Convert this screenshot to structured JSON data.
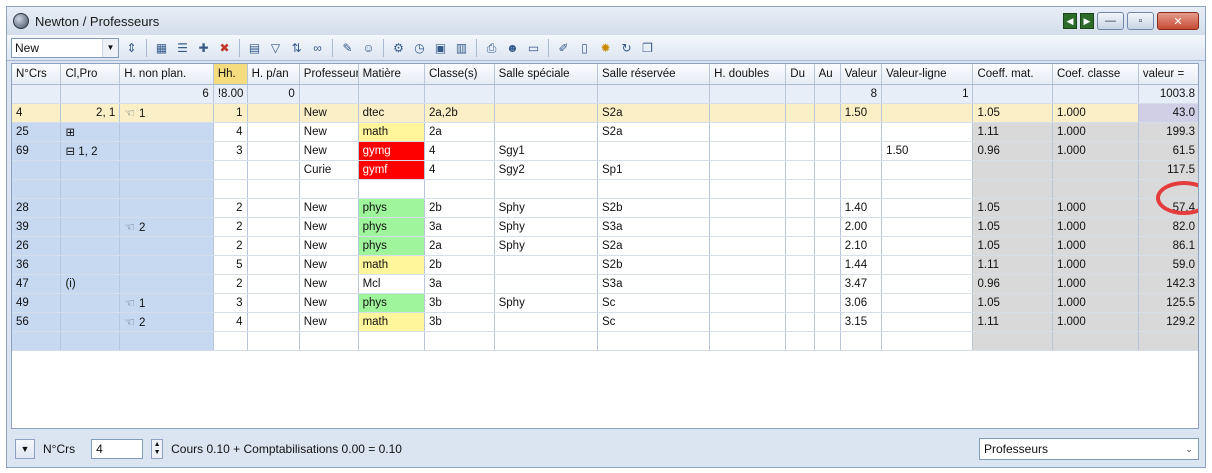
{
  "window": {
    "title": "Newton / Professeurs"
  },
  "toolbar": {
    "filter_value": "New",
    "icons": [
      "grid-icon",
      "list-icon",
      "new-icon",
      "delete-icon",
      "chart-icon",
      "filter-icon",
      "sort-icon",
      "link-icon",
      "tools-icon",
      "teacher-icon",
      "settings-icon",
      "clock-icon",
      "calendar-icon",
      "table-icon",
      "print-icon",
      "people-icon",
      "monitor-icon",
      "edit-icon",
      "document-icon",
      "gear-icon",
      "cycle-icon",
      "window-icon"
    ]
  },
  "table": {
    "headers": [
      "N°Crs",
      "Cl,Pro",
      "H. non plan.",
      "Hh.",
      "H. p/an",
      "Professeur",
      "Matière",
      "Classe(s)",
      "Salle spéciale",
      "Salle réservée",
      "H. doubles",
      "Du",
      "Au",
      "Valeur",
      "Valeur-ligne",
      "Coeff. mat.",
      "Coef. classe",
      "valeur ="
    ],
    "sum_row": [
      "",
      "",
      "6",
      "!8.00",
      "0",
      "",
      "",
      "",
      "",
      "",
      "",
      "",
      "",
      "8",
      "1",
      "",
      "",
      "1003.8"
    ],
    "rows": [
      {
        "crs": "4",
        "cl": "2, 1",
        "hnp": "1",
        "hh": "1",
        "hpan": "",
        "prof": "New",
        "mat": "dtec",
        "mat_style": "none",
        "cls": "2a,2b",
        "ss": "",
        "sr": "S2a",
        "hd": "",
        "du": "",
        "au": "",
        "val": "1.50",
        "vl": "",
        "cm": "1.05",
        "cc": "1.000",
        "v": "43.0",
        "selected": true
      },
      {
        "crs": "25",
        "cl": "⊞",
        "hnp": "",
        "hh": "4",
        "hpan": "",
        "prof": "New",
        "mat": "math",
        "mat_style": "math",
        "cls": "2a",
        "ss": "",
        "sr": "S2a",
        "hd": "",
        "du": "",
        "au": "",
        "val": "",
        "vl": "",
        "cm": "1.11",
        "cc": "1.000",
        "v": "199.3"
      },
      {
        "crs": "69",
        "cl": "⊟ 1, 2",
        "hnp": "",
        "hh": "3",
        "hpan": "",
        "prof": "New",
        "mat": "gymg",
        "mat_style": "gym",
        "cls": "4",
        "ss": "Sgy1",
        "sr": "",
        "hd": "",
        "du": "",
        "au": "",
        "val": "",
        "vl": "1.50",
        "cm": "0.96",
        "cc": "1.000",
        "v": "61.5"
      },
      {
        "crs": "",
        "cl": "",
        "hnp": "",
        "hh": "",
        "hpan": "",
        "prof": "Curie",
        "mat": "gymf",
        "mat_style": "gym",
        "cls": "4",
        "ss": "Sgy2",
        "sr": "Sp1",
        "hd": "",
        "du": "",
        "au": "",
        "val": "",
        "vl": "",
        "cm": "",
        "cc": "",
        "v": "117.5"
      },
      {
        "crs": "",
        "cl": "",
        "hnp": "",
        "hh": "",
        "hpan": "",
        "prof": "",
        "mat": "",
        "mat_style": "none",
        "cls": "",
        "ss": "",
        "sr": "",
        "hd": "",
        "du": "",
        "au": "",
        "val": "",
        "vl": "",
        "cm": "",
        "cc": "",
        "v": ""
      },
      {
        "crs": "28",
        "cl": "",
        "hnp": "",
        "hh": "2",
        "hpan": "",
        "prof": "New",
        "mat": "phys",
        "mat_style": "phys",
        "cls": "2b",
        "ss": "Sphy",
        "sr": "S2b",
        "hd": "",
        "du": "",
        "au": "",
        "val": "1.40",
        "vl": "",
        "cm": "1.05",
        "cc": "1.000",
        "v": "57.4"
      },
      {
        "crs": "39",
        "cl": "",
        "hnp": "2",
        "hh": "2",
        "hpan": "",
        "prof": "New",
        "mat": "phys",
        "mat_style": "phys",
        "cls": "3a",
        "ss": "Sphy",
        "sr": "S3a",
        "hd": "",
        "du": "",
        "au": "",
        "val": "2.00",
        "vl": "",
        "cm": "1.05",
        "cc": "1.000",
        "v": "82.0"
      },
      {
        "crs": "26",
        "cl": "",
        "hnp": "",
        "hh": "2",
        "hpan": "",
        "prof": "New",
        "mat": "phys",
        "mat_style": "phys",
        "cls": "2a",
        "ss": "Sphy",
        "sr": "S2a",
        "hd": "",
        "du": "",
        "au": "",
        "val": "2.10",
        "vl": "",
        "cm": "1.05",
        "cc": "1.000",
        "v": "86.1"
      },
      {
        "crs": "36",
        "cl": "",
        "hnp": "",
        "hh": "5",
        "hpan": "",
        "prof": "New",
        "mat": "math",
        "mat_style": "math",
        "cls": "2b",
        "ss": "",
        "sr": "S2b",
        "hd": "",
        "du": "",
        "au": "",
        "val": "1.44",
        "vl": "",
        "cm": "1.11",
        "cc": "1.000",
        "v": "59.0"
      },
      {
        "crs": "47",
        "cl": "(i)",
        "hnp": "",
        "hh": "2",
        "hpan": "",
        "prof": "New",
        "mat": "Mcl",
        "mat_style": "none",
        "cls": "3a",
        "ss": "",
        "sr": "S3a",
        "hd": "",
        "du": "",
        "au": "",
        "val": "3.47",
        "vl": "",
        "cm": "0.96",
        "cc": "1.000",
        "v": "142.3"
      },
      {
        "crs": "49",
        "cl": "",
        "hnp": "1",
        "hh": "3",
        "hpan": "",
        "prof": "New",
        "mat": "phys",
        "mat_style": "phys",
        "cls": "3b",
        "ss": "Sphy",
        "sr": "Sc",
        "hd": "",
        "du": "",
        "au": "",
        "val": "3.06",
        "vl": "",
        "cm": "1.05",
        "cc": "1.000",
        "v": "125.5"
      },
      {
        "crs": "56",
        "cl": "",
        "hnp": "2",
        "hh": "4",
        "hpan": "",
        "prof": "New",
        "mat": "math",
        "mat_style": "math",
        "cls": "3b",
        "ss": "",
        "sr": "Sc",
        "hd": "",
        "du": "",
        "au": "",
        "val": "3.15",
        "vl": "",
        "cm": "1.11",
        "cc": "1.000",
        "v": "129.2"
      },
      {
        "crs": "",
        "cl": "",
        "hnp": "",
        "hh": "",
        "hpan": "",
        "prof": "",
        "mat": "",
        "mat_style": "none",
        "cls": "",
        "ss": "",
        "sr": "",
        "hd": "",
        "du": "",
        "au": "",
        "val": "",
        "vl": "",
        "cm": "",
        "cc": "",
        "v": ""
      }
    ]
  },
  "status": {
    "field_label": "N°Crs",
    "field_value": "4",
    "summary": "Cours 0.10 + Comptabilisations 0.00 = 0.10",
    "view_select": "Professeurs"
  },
  "colors": {
    "highlight_ring": "#e43c3c",
    "phys": "#9ff59b",
    "math": "#fff59a",
    "gym": "#ff0000"
  }
}
